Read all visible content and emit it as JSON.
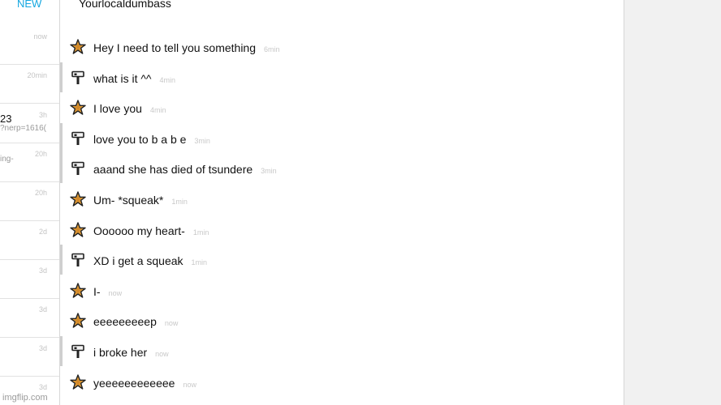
{
  "sidebar": {
    "new_label": "NEW",
    "conversations": [
      {
        "time": "now",
        "title": "",
        "snippet": ""
      },
      {
        "time": "20min",
        "title": "",
        "snippet": ""
      },
      {
        "time": "3h",
        "title": "23",
        "snippet": "?nerp=1616("
      },
      {
        "time": "20h",
        "title": "",
        "snippet": "ing-"
      },
      {
        "time": "20h",
        "title": "",
        "snippet": ""
      },
      {
        "time": "2d",
        "title": "",
        "snippet": ""
      },
      {
        "time": "3d",
        "title": "",
        "snippet": ""
      },
      {
        "time": "3d",
        "title": "",
        "snippet": ""
      },
      {
        "time": "3d",
        "title": "",
        "snippet": ""
      },
      {
        "time": "3d",
        "title": "",
        "snippet": ""
      }
    ],
    "watermark": "imgflip.com"
  },
  "chat": {
    "title": "Yourlocaldumbass",
    "messages": [
      {
        "sender": "star",
        "text": "Hey I need to tell you something",
        "time": "6min"
      },
      {
        "sender": "hammer",
        "text": "what is it ^^",
        "time": "4min"
      },
      {
        "sender": "star",
        "text": "I love you",
        "time": "4min"
      },
      {
        "sender": "hammer",
        "text": "love you to b a b e",
        "time": "3min"
      },
      {
        "sender": "hammer",
        "text": "aaand she has died of tsundere",
        "time": "3min"
      },
      {
        "sender": "star",
        "text": "Um- *squeak*",
        "time": "1min"
      },
      {
        "sender": "star",
        "text": "Oooooo my heart-",
        "time": "1min"
      },
      {
        "sender": "hammer",
        "text": "XD i get a squeak",
        "time": "1min"
      },
      {
        "sender": "star",
        "text": "I-",
        "time": "now"
      },
      {
        "sender": "star",
        "text": "eeeeeeeeep",
        "time": "now"
      },
      {
        "sender": "hammer",
        "text": "i broke her",
        "time": "now"
      },
      {
        "sender": "star",
        "text": "yeeeeeeeeeeee",
        "time": "now"
      }
    ]
  },
  "icons": {
    "star_avatar": "star-icon",
    "hammer_avatar": "hammer-icon"
  },
  "colors": {
    "accent": "#15a7e0",
    "star_fill": "#e8a23a"
  }
}
